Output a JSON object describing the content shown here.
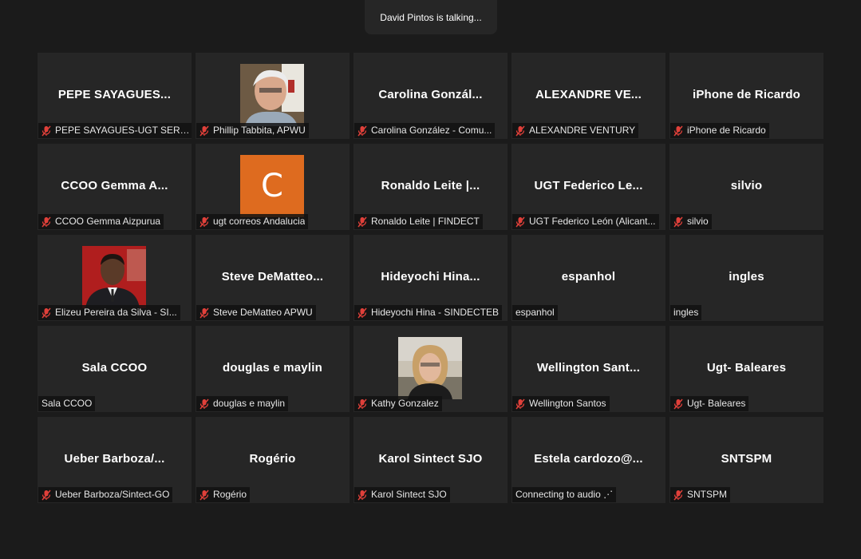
{
  "banner": {
    "text": "David Pintos is talking..."
  },
  "colors": {
    "background": "#1b1b1b",
    "tile": "#262626",
    "muted_icon": "#e0403a",
    "letter_avatar": "#de6b1f"
  },
  "participants": [
    {
      "title": "PEPE SAYAGUES...",
      "label": "PEPE SAYAGUES-UGT SERV...",
      "muted": true
    },
    {
      "title": "",
      "label": "Phillip Tabbita, APWU",
      "muted": true,
      "avatar": "photo-icon"
    },
    {
      "title": "Carolina  Gonzál...",
      "label": "Carolina González - Comu...",
      "muted": true
    },
    {
      "title": "ALEXANDRE VE...",
      "label": "ALEXANDRE VENTURY",
      "muted": true
    },
    {
      "title": "iPhone de Ricardo",
      "label": "iPhone de Ricardo",
      "muted": true
    },
    {
      "title": "CCOO Gemma A...",
      "label": "CCOO Gemma Aizpurua",
      "muted": true
    },
    {
      "title": "",
      "label": "ugt correos Andalucia",
      "muted": true,
      "avatar_letter": "C"
    },
    {
      "title": "Ronaldo Leite |...",
      "label": "Ronaldo Leite | FINDECT",
      "muted": true
    },
    {
      "title": "UGT Federico Le...",
      "label": "UGT Federico León (Alicant...",
      "muted": true
    },
    {
      "title": "silvio",
      "label": "silvio",
      "muted": true
    },
    {
      "title": "",
      "label": "Elizeu Pereira da Silva - SI...",
      "muted": true,
      "avatar": "photo-icon"
    },
    {
      "title": "Steve DeMatteo...",
      "label": "Steve DeMatteo APWU",
      "muted": true
    },
    {
      "title": "Hideyochi  Hina...",
      "label": "Hideyochi Hina - SINDECTEB",
      "muted": true
    },
    {
      "title": "espanhol",
      "label": "espanhol",
      "muted": false
    },
    {
      "title": "ingles",
      "label": "ingles",
      "muted": false
    },
    {
      "title": "Sala CCOO",
      "label": "Sala CCOO",
      "muted": false
    },
    {
      "title": "douglas e maylin",
      "label": "douglas e maylin",
      "muted": true
    },
    {
      "title": "",
      "label": "Kathy Gonzalez",
      "muted": true,
      "avatar": "photo-icon"
    },
    {
      "title": "Wellington  Sant...",
      "label": "Wellington Santos",
      "muted": true
    },
    {
      "title": "Ugt- Baleares",
      "label": "Ugt- Baleares",
      "muted": true
    },
    {
      "title": "Ueber  Barboza/...",
      "label": "Ueber Barboza/Sintect-GO",
      "muted": true
    },
    {
      "title": "Rogério",
      "label": "Rogério",
      "muted": true
    },
    {
      "title": "Karol Sintect SJO",
      "label": "Karol Sintect SJO",
      "muted": true
    },
    {
      "title": "Estela  cardozo@...",
      "label": "Connecting to audio ⋰",
      "muted": false
    },
    {
      "title": "SNTSPM",
      "label": "SNTSPM",
      "muted": true
    }
  ]
}
